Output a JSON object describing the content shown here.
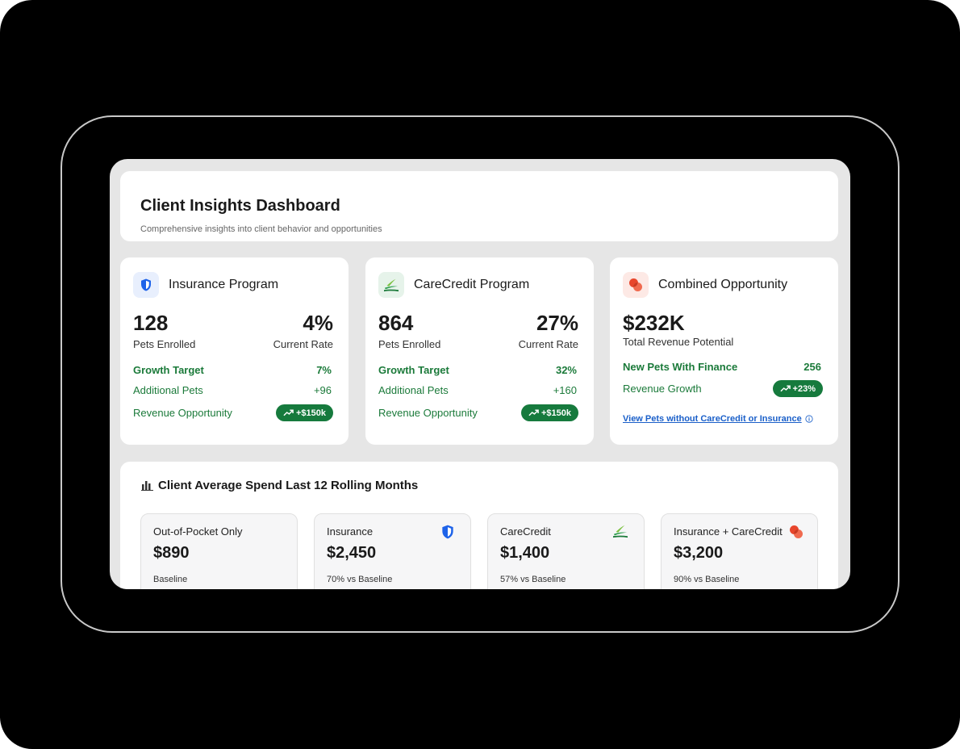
{
  "header": {
    "title": "Client Insights Dashboard",
    "subtitle": "Comprehensive insights into client behavior and opportunities"
  },
  "programs": [
    {
      "title": "Insurance Program",
      "icon": "shield-icon",
      "enrolled_value": "128",
      "enrolled_label": "Pets Enrolled",
      "rate_value": "4%",
      "rate_label": "Current Rate",
      "growth_label": "Growth Target",
      "growth_value": "7%",
      "additional_label": "Additional Pets",
      "additional_value": "+96",
      "revenue_label": "Revenue Opportunity",
      "revenue_value": "+$150k"
    },
    {
      "title": "CareCredit Program",
      "icon": "carecredit-logo-icon",
      "enrolled_value": "864",
      "enrolled_label": "Pets Enrolled",
      "rate_value": "27%",
      "rate_label": "Current Rate",
      "growth_label": "Growth Target",
      "growth_value": "32%",
      "additional_label": "Additional Pets",
      "additional_value": "+160",
      "revenue_label": "Revenue Opportunity",
      "revenue_value": "+$150k"
    }
  ],
  "combined": {
    "title": "Combined Opportunity",
    "icon": "overlapping-circles-icon",
    "total_value": "$232K",
    "total_label": "Total Revenue Potential",
    "new_pets_label": "New Pets With Finance",
    "new_pets_value": "256",
    "growth_label": "Revenue Growth",
    "growth_value": "+23%",
    "link_text": "View Pets without CareCredit or Insurance"
  },
  "spend": {
    "title": "Client Average Spend Last 12 Rolling Months",
    "cards": [
      {
        "label": "Out-of-Pocket Only",
        "value": "$890",
        "note": "Baseline"
      },
      {
        "label": "Insurance",
        "value": "$2,450",
        "note": "70% vs Baseline",
        "icon": "shield-icon"
      },
      {
        "label": "CareCredit",
        "value": "$1,400",
        "note": "57% vs Baseline",
        "icon": "carecredit-logo-icon"
      },
      {
        "label": "Insurance + CareCredit",
        "value": "$3,200",
        "note": "90% vs Baseline",
        "icon": "overlapping-circles-icon"
      }
    ]
  },
  "colors": {
    "accent_green": "#167a3d",
    "text_green": "#1b7a3a",
    "link_blue": "#1a5fc9",
    "shield_blue": "#1e63e9",
    "combined_red": "#e8462c"
  }
}
